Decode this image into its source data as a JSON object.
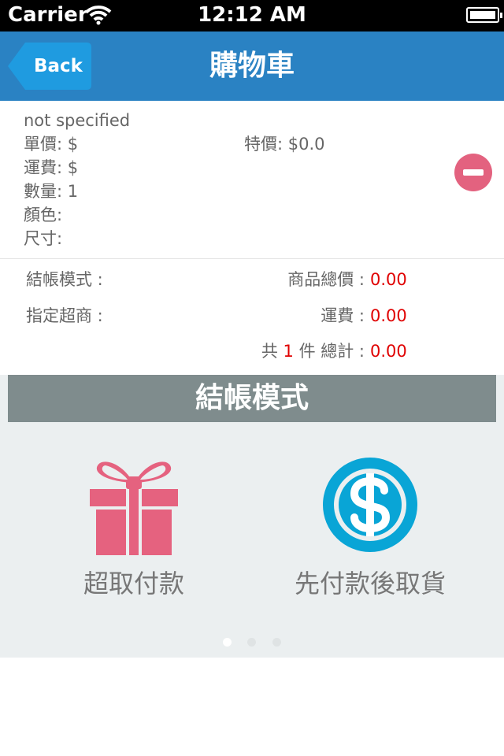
{
  "status_bar": {
    "carrier": "Carrier",
    "time": "12:12 AM"
  },
  "nav": {
    "back_label": "Back",
    "title": "購物車"
  },
  "item": {
    "name": "not specified",
    "unit_price": "單價: $",
    "special_price": "特價: $0.0",
    "shipping": "運費: $",
    "quantity": "數量: 1",
    "color": "顏色:",
    "size": "尺寸:"
  },
  "summary": {
    "checkout_mode_label": "結帳模式 :",
    "store_label": "指定超商 :",
    "goods_total_label": "商品總價 :",
    "goods_total_value": "0.00",
    "shipping_label": "運費 :",
    "shipping_value": "0.00",
    "count_prefix": "共",
    "count": "1",
    "count_suffix": "件 總計 :",
    "grand_total_value": "0.00"
  },
  "checkout_mode": {
    "header": "結帳模式",
    "options": [
      {
        "label": "超取付款",
        "icon": "gift-icon",
        "color": "#e5627f"
      },
      {
        "label": "先付款後取貨",
        "icon": "dollar-coin-icon",
        "color": "#09a5d6"
      }
    ],
    "page_count": 3,
    "current_page": 1
  },
  "colors": {
    "nav": "#2a82c3",
    "accent_red": "#e00000",
    "mode_header": "#7f8c8d"
  }
}
